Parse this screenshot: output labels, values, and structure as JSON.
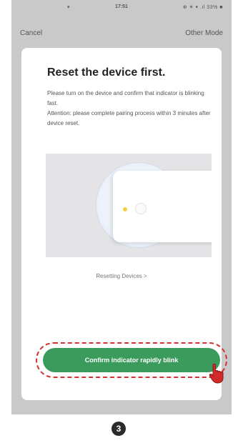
{
  "status_bar": {
    "wifi": "▾",
    "time": "17:51",
    "indicators": "⊕ ✶ ▾ .ıl 33% ■"
  },
  "nav": {
    "cancel_label": "Cancel",
    "other_mode_label": "Other Mode"
  },
  "content": {
    "title": "Reset the device first.",
    "description_line1": "Please turn on the device and confirm that indicator is blinking fast.",
    "description_line2": "Attention: please complete pairing process within 3 minutes after device reset.",
    "resetting_link": "Resetting Devices >",
    "confirm_button_label": "Confirm indicator rapidly blink"
  },
  "step_number": "3",
  "colors": {
    "confirm_button": "#3a9b5c",
    "highlight_outline": "#d6302f",
    "indicator_led": "#f4d03f"
  },
  "icons": {
    "pointer": "hand-pointer-icon",
    "led": "indicator-led-icon"
  }
}
